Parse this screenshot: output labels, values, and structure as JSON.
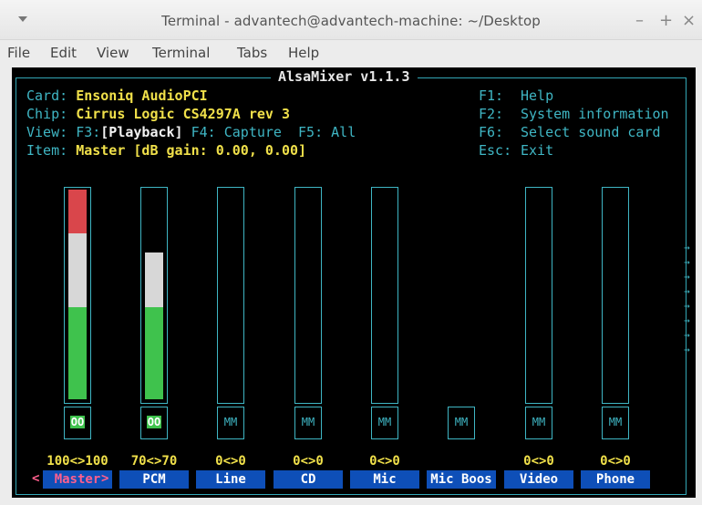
{
  "window": {
    "title": "Terminal - advantech@advantech-machine: ~/Desktop",
    "buttons": {
      "minimize": "–",
      "maximize": "+",
      "close": "×"
    }
  },
  "menubar": [
    "File",
    "Edit",
    "View",
    "Terminal",
    "Tabs",
    "Help"
  ],
  "alsamixer": {
    "title": "AlsaMixer v1.1.3",
    "card_label": "Card:",
    "card_value": "Ensoniq AudioPCI",
    "chip_label": "Chip:",
    "chip_value": "Cirrus Logic CS4297A rev 3",
    "view_label": "View:",
    "view_f3": "F3:",
    "view_playback": "[Playback]",
    "view_f4": "F4: Capture",
    "view_f5": "F5: All",
    "item_label": "Item:",
    "item_value": "Master [dB gain: 0.00, 0.00]",
    "keys": [
      {
        "key": "F1:",
        "action": "Help"
      },
      {
        "key": "F2:",
        "action": "System information"
      },
      {
        "key": "F6:",
        "action": "Select sound card"
      },
      {
        "key": "Esc:",
        "action": "Exit"
      }
    ],
    "channels": [
      {
        "name": "Master",
        "level": 100,
        "volume": "100<>100",
        "mute": "OO",
        "selected": true,
        "has_bar": true
      },
      {
        "name": "PCM",
        "level": 70,
        "volume": "70<>70",
        "mute": "OO",
        "selected": false,
        "has_bar": true
      },
      {
        "name": "Line",
        "level": 0,
        "volume": "0<>0",
        "mute": "MM",
        "selected": false,
        "has_bar": true
      },
      {
        "name": "CD",
        "level": 0,
        "volume": "0<>0",
        "mute": "MM",
        "selected": false,
        "has_bar": true
      },
      {
        "name": "Mic",
        "level": 0,
        "volume": "0<>0",
        "mute": "MM",
        "selected": false,
        "has_bar": true
      },
      {
        "name": "Mic Boos",
        "level": 0,
        "volume": "",
        "mute": "MM",
        "selected": false,
        "has_bar": false
      },
      {
        "name": "Video",
        "level": 0,
        "volume": "0<>0",
        "mute": "MM",
        "selected": false,
        "has_bar": true
      },
      {
        "name": "Phone",
        "level": 0,
        "volume": "0<>0",
        "mute": "MM",
        "selected": false,
        "has_bar": true
      }
    ],
    "selection_left": "<",
    "selection_right": ">",
    "colors": {
      "background": "#000000",
      "frame": "#3fb6c4",
      "label": "#3fb6c4",
      "value": "#f0e04a",
      "bar_low": "#3fc24d",
      "bar_mid": "#d7d7d7",
      "bar_high": "#d9464b",
      "name_bg": "#0e4fb8",
      "selected_text": "#ff5f8d"
    }
  }
}
